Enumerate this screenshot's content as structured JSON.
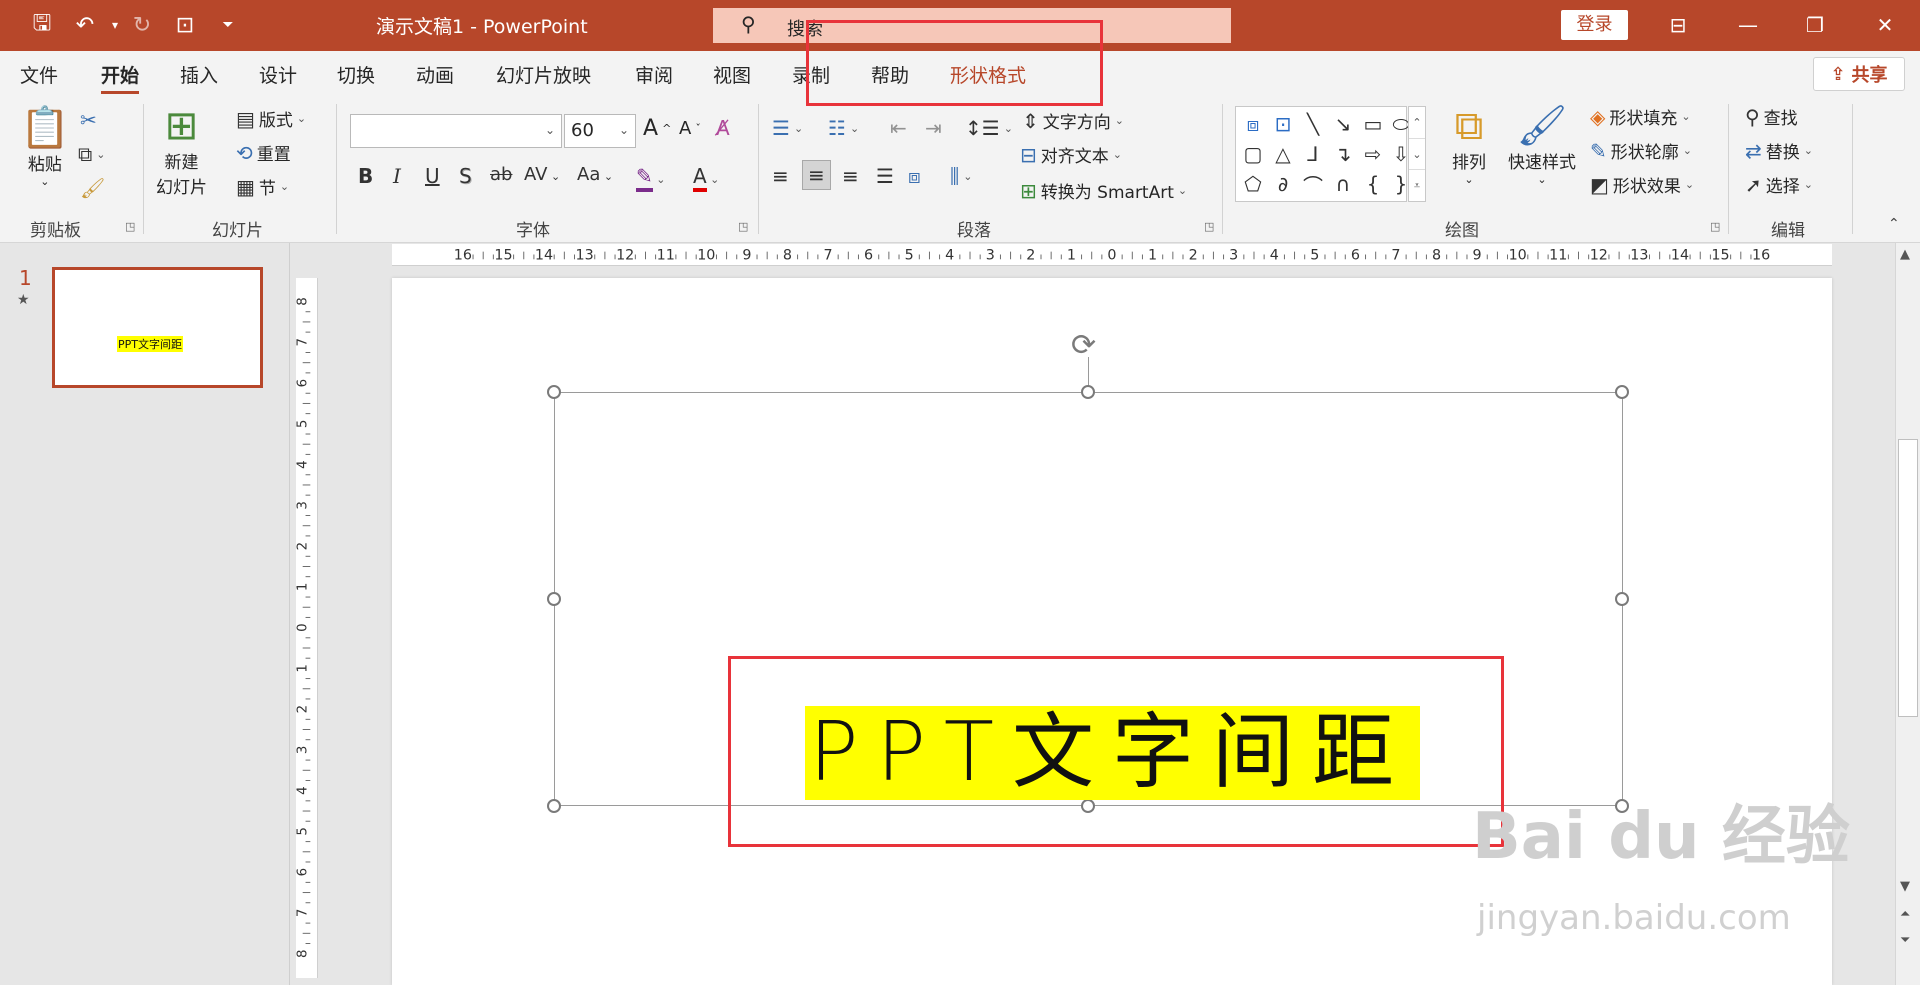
{
  "titlebar": {
    "doc_title": "演示文稿1  -  PowerPoint",
    "search_placeholder": "搜索",
    "login_label": "登录",
    "icons": [
      "save-icon",
      "undo-icon",
      "redo-icon",
      "present-icon",
      "customize-icon"
    ]
  },
  "tabs": {
    "items": [
      "文件",
      "开始",
      "插入",
      "设计",
      "切换",
      "动画",
      "幻灯片放映",
      "审阅",
      "视图",
      "录制",
      "帮助",
      "形状格式"
    ],
    "active": "开始",
    "share_label": "共享"
  },
  "ribbon": {
    "clipboard": {
      "label": "剪贴板",
      "paste": "粘贴"
    },
    "slides": {
      "label": "幻灯片",
      "new_slide_line1": "新建",
      "new_slide_line2": "幻灯片",
      "layout": "版式",
      "reset": "重置",
      "section": "节"
    },
    "font": {
      "label": "字体",
      "font_name": "",
      "font_size": "60",
      "bold": "B",
      "italic": "I",
      "underline": "U",
      "shadow": "S",
      "strike": "ab",
      "spacing": "AV",
      "case": "Aa",
      "grow": "A",
      "shrink": "A"
    },
    "paragraph": {
      "label": "段落",
      "text_direction": "文字方向",
      "align_text": "对齐文本",
      "smartart": "转换为 SmartArt"
    },
    "drawing": {
      "label": "绘图",
      "arrange": "排列",
      "quick_styles": "快速样式",
      "shape_fill": "形状填充",
      "shape_outline": "形状轮廓",
      "shape_effects": "形状效果"
    },
    "editing": {
      "label": "编辑",
      "find": "查找",
      "replace": "替换",
      "select": "选择"
    }
  },
  "thumbnails": {
    "slide_number": "1",
    "slide_text": "PPT文字间距"
  },
  "slide": {
    "text": "PPT文字间距"
  },
  "rulers": {
    "h_labels": [
      "16",
      "15",
      "14",
      "13",
      "12",
      "11",
      "10",
      "9",
      "8",
      "7",
      "6",
      "5",
      "4",
      "3",
      "2",
      "1",
      "0",
      "1",
      "2",
      "3",
      "4",
      "5",
      "6",
      "7",
      "8",
      "9",
      "10",
      "11",
      "12",
      "13",
      "14",
      "15",
      "16"
    ],
    "v_labels": [
      "8",
      "7",
      "6",
      "5",
      "4",
      "3",
      "2",
      "1",
      "0",
      "1",
      "2",
      "3",
      "4",
      "5",
      "6",
      "7",
      "8"
    ]
  },
  "watermark": {
    "brand": "Bai  du 经验",
    "url": "jingyan.baidu.com"
  },
  "colors": {
    "accent": "#b7472a",
    "highlight": "#ffff00",
    "annotation": "#e8333a"
  }
}
